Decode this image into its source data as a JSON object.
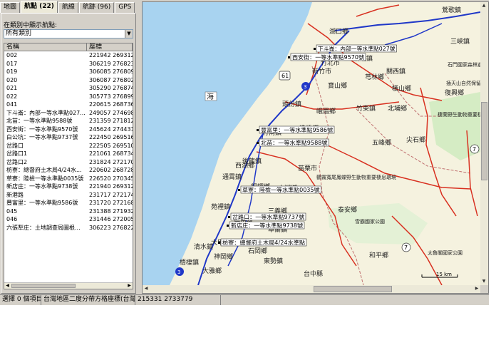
{
  "tabs": [
    {
      "label": "地圖"
    },
    {
      "label": "航點 (22)"
    },
    {
      "label": "航線"
    },
    {
      "label": "航跡 (96)"
    },
    {
      "label": "GPS"
    }
  ],
  "waypoints_panel": {
    "filter_label": "在類別中顯示航點:",
    "filter_value": "所有類別",
    "columns": {
      "name": "名稱",
      "coord": "座標"
    },
    "rows": [
      {
        "name": "002",
        "coord": "221942 2693126"
      },
      {
        "name": "017",
        "coord": "306219 2768236"
      },
      {
        "name": "019",
        "coord": "306085 2768090"
      },
      {
        "name": "020",
        "coord": "306087 2768029"
      },
      {
        "name": "021",
        "coord": "305290 2768747"
      },
      {
        "name": "022",
        "coord": "305773 2768993"
      },
      {
        "name": "041",
        "coord": "220615 2687367"
      },
      {
        "name": "下斗崙：內部一等水準點027...",
        "coord": "249057 2746982"
      },
      {
        "name": "北苗：一等水準點9588號",
        "coord": "231359 2718126"
      },
      {
        "name": "西安街：一等水準點9570號",
        "coord": "245624 2744315"
      },
      {
        "name": "白公坑：一等水準點9737號",
        "coord": "222450 2695164"
      },
      {
        "name": "岔路口",
        "coord": "222505 2695109"
      },
      {
        "name": "岔路口1",
        "coord": "221061 2687341"
      },
      {
        "name": "岔路口2",
        "coord": "231824 2721709"
      },
      {
        "name": "枋寮：總督府土木局4/24水...",
        "coord": "220602 2687280"
      },
      {
        "name": "草寮：陸檢一等水準點0035號",
        "coord": "226520 2703450"
      },
      {
        "name": "新店庄：一等水準點9738號",
        "coord": "221940 2693127"
      },
      {
        "name": "新港路",
        "coord": "231717 2721748"
      },
      {
        "name": "豐富里：一等水準點9586號",
        "coord": "231720 2721686"
      },
      {
        "name": "045",
        "coord": "231388 2719327"
      },
      {
        "name": "046",
        "coord": "231446 2720053"
      },
      {
        "name": "六張犁庄：土地調查局圖根...",
        "coord": "306223 2768229"
      }
    ]
  },
  "map": {
    "sea_label": "海",
    "places": [
      {
        "id": "yingge",
        "text": "鶯歌鎮"
      },
      {
        "id": "hukou",
        "text": "湖口鄉"
      },
      {
        "id": "xinpu",
        "text": "新埔鎮"
      },
      {
        "id": "guanxi",
        "text": "關西鎮"
      },
      {
        "id": "sanxia",
        "text": "三峽鎮"
      },
      {
        "id": "fuxing",
        "text": "復興鄉"
      },
      {
        "id": "xinzhu",
        "text": "新竹市"
      },
      {
        "id": "baoshan",
        "text": "寶山鄉"
      },
      {
        "id": "qionglin",
        "text": "芎林鄉"
      },
      {
        "id": "beipu",
        "text": "北埔鄉"
      },
      {
        "id": "hengshan",
        "text": "橫山鄉"
      },
      {
        "id": "jianshi",
        "text": "尖石鄉"
      },
      {
        "id": "wufeng",
        "text": "五峰鄉"
      },
      {
        "id": "zhubei",
        "text": "竹北市"
      },
      {
        "id": "zhudong",
        "text": "竹東鎮"
      },
      {
        "id": "zhunan",
        "text": "竹南鎮"
      },
      {
        "id": "toufen",
        "text": "頭份鎮"
      },
      {
        "id": "emei",
        "text": "峨眉鄉"
      },
      {
        "id": "zaoqiao",
        "text": "造橋鄉"
      },
      {
        "id": "houlong",
        "text": "後龍鎮"
      },
      {
        "id": "xihu",
        "text": "西湖鄉"
      },
      {
        "id": "miaoli",
        "text": "苗栗市"
      },
      {
        "id": "tongluo",
        "text": "銅鑼鄉"
      },
      {
        "id": "tongxiao",
        "text": "通霄鎮"
      },
      {
        "id": "yuanli",
        "text": "苑裡鎮"
      },
      {
        "id": "sanyi",
        "text": "三義鄉"
      },
      {
        "id": "tai_an",
        "text": "泰安鄉"
      },
      {
        "id": "dahu",
        "text": "大湖鄉"
      },
      {
        "id": "houli",
        "text": "后里鄉"
      },
      {
        "id": "dajia",
        "text": "大甲鎮"
      },
      {
        "id": "qingshui",
        "text": "清水鎮"
      },
      {
        "id": "shengang",
        "text": "神岡鄉"
      },
      {
        "id": "dongshi",
        "text": "東勢鎮"
      },
      {
        "id": "zhuolan",
        "text": "卓蘭鎮"
      },
      {
        "id": "taichung",
        "text": "台中縣"
      },
      {
        "id": "heping",
        "text": "和平鄉"
      },
      {
        "id": "wuqi",
        "text": "梧棲鎮"
      },
      {
        "id": "dachuan",
        "text": "大雅鄉"
      },
      {
        "id": "shipa",
        "text": "石岡鄉"
      },
      {
        "id": "xueba",
        "text": "雪霸國家公園"
      },
      {
        "id": "taroko",
        "text": "太魯閣國家公園"
      },
      {
        "id": "guanwu",
        "text": "觀霧寬尾鳳蝶野生動物重要棲息環境"
      },
      {
        "id": "lalashan",
        "text": "插天山自然保留區"
      },
      {
        "id": "lala2",
        "text": "棲蘭野生動物重要棲息環境"
      },
      {
        "id": "shimen",
        "text": "石門國家森林遊樂區"
      }
    ],
    "waypoint_tags": [
      {
        "id": "w1",
        "text": "下斗崙：內部一等水準點027號"
      },
      {
        "id": "w2",
        "text": "西安街：一等水準點9570號"
      },
      {
        "id": "w3",
        "text": "豐富里：一等水準點9586號"
      },
      {
        "id": "w4",
        "text": "北苗：一等水準點9588號"
      },
      {
        "id": "w5",
        "text": "草寮：陸檢一等水準點0035號"
      },
      {
        "id": "w6",
        "text": "岔路口：一等水準點9737號"
      },
      {
        "id": "w7",
        "text": "新店庄：一等水準點9738號"
      },
      {
        "id": "w8",
        "text": "枋寮：總督府土木局4/24水準點"
      }
    ],
    "shields": {
      "r61": "61",
      "r3": "3",
      "r7a": "7",
      "r7b": "7",
      "r3b": "3",
      "r1": "1"
    },
    "scale_label": "15 km",
    "colors": {
      "sea": "#a8d3f0",
      "land": "#f5f2df",
      "park": "#d5ecc4",
      "road_red": "#d83020",
      "road_blue": "#2038c8",
      "border": "#c07070"
    }
  },
  "status": {
    "selected": "選擇 0 個項目",
    "projection": "台灣地區二度分帶方格座標(台灣)",
    "cursor": "215331 2733779"
  }
}
